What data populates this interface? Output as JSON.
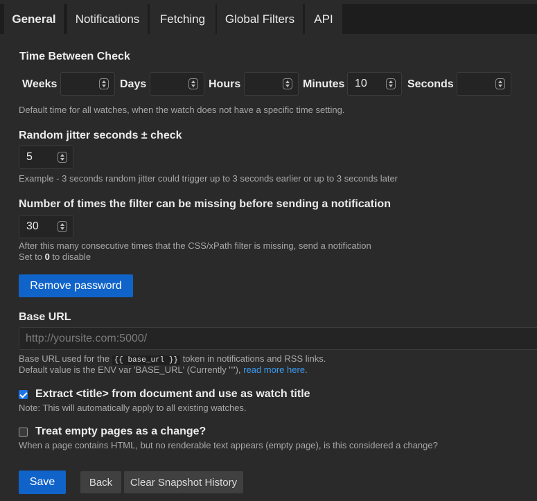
{
  "tabs": [
    {
      "label": "General",
      "active": true
    },
    {
      "label": "Notifications"
    },
    {
      "label": "Fetching"
    },
    {
      "label": "Global Filters"
    },
    {
      "label": "API"
    }
  ],
  "time_between_check": {
    "title": "Time Between Check",
    "fields": [
      {
        "label": "Weeks",
        "value": ""
      },
      {
        "label": "Days",
        "value": ""
      },
      {
        "label": "Hours",
        "value": ""
      },
      {
        "label": "Minutes",
        "value": "10"
      },
      {
        "label": "Seconds",
        "value": ""
      }
    ],
    "help": "Default time for all watches, when the watch does not have a specific time setting."
  },
  "jitter": {
    "title": "Random jitter seconds ± check",
    "value": "5",
    "help": "Example - 3 seconds random jitter could trigger up to 3 seconds earlier or up to 3 seconds later"
  },
  "filter_missing": {
    "title": "Number of times the filter can be missing before sending a notification",
    "value": "30",
    "help_line1": "After this many consecutive times that the CSS/xPath filter is missing, send a notification",
    "help_line2_pre": "Set to ",
    "help_line2_bold": "0",
    "help_line2_post": " to disable"
  },
  "remove_password_label": "Remove password",
  "base_url": {
    "title": "Base URL",
    "placeholder": "http://yoursite.com:5000/",
    "help_pre": "Base URL used for the ",
    "help_code": "{{ base_url }}",
    "help_post": " token in notifications and RSS links.",
    "help2_pre": "Default value is the ENV var 'BASE_URL' (Currently \"\"), ",
    "help2_link": "read more here",
    "help2_post": "."
  },
  "extract_title": {
    "checked": true,
    "label": "Extract <title> from document and use as watch title",
    "help": "Note: This will automatically apply to all existing watches."
  },
  "empty_pages": {
    "checked": false,
    "label": "Treat empty pages as a change?",
    "help": "When a page contains HTML, but no renderable text appears (empty page), is this considered a change?"
  },
  "actions": {
    "save": "Save",
    "back": "Back",
    "clear_history": "Clear Snapshot History"
  },
  "colors": {
    "background": "#2a2a2a",
    "primary_button": "#0f63c9",
    "link": "#3b9cf2",
    "checkbox_checked": "#1d74e8"
  }
}
